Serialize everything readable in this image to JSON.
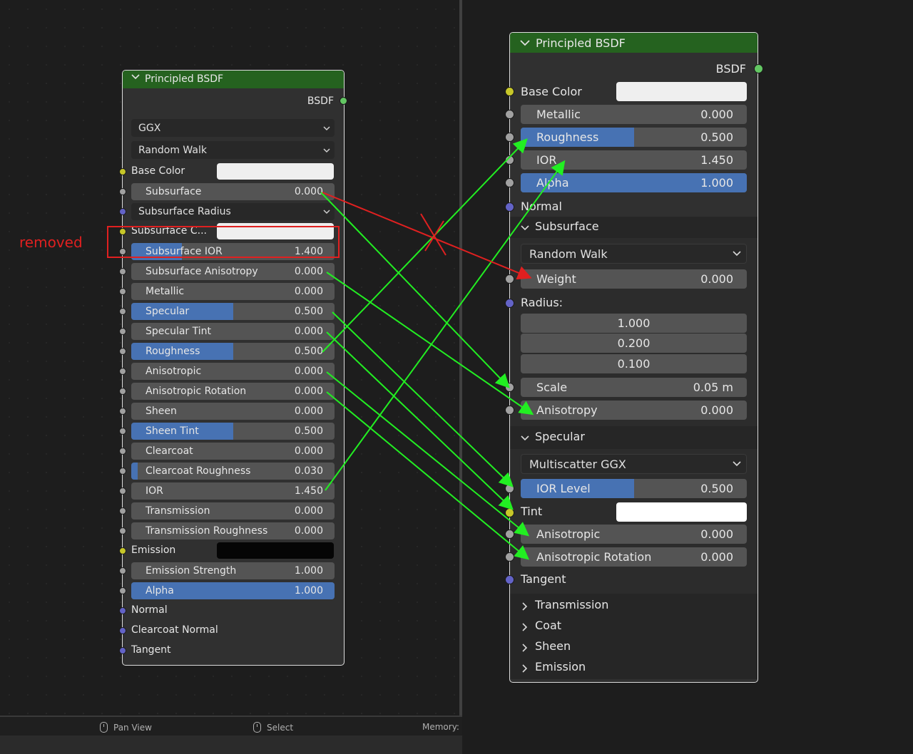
{
  "annotation": {
    "label": "removed"
  },
  "statusbar": {
    "pan": "Pan View",
    "select": "Select",
    "memory": "Memory: "
  },
  "left_node": {
    "title": "Principled BSDF",
    "output": "BSDF",
    "dropdown1": "GGX",
    "dropdown2": "Random Walk",
    "base_color": "Base Color",
    "subsurface": {
      "label": "Subsurface",
      "value": "0.000"
    },
    "subsurface_radius": "Subsurface Radius",
    "subsurface_color": "Subsurface C...",
    "subsurface_ior": {
      "label": "Subsurface IOR",
      "value": "1.400"
    },
    "subsurface_anisotropy": {
      "label": "Subsurface Anisotropy",
      "value": "0.000"
    },
    "metallic": {
      "label": "Metallic",
      "value": "0.000"
    },
    "specular": {
      "label": "Specular",
      "value": "0.500"
    },
    "specular_tint": {
      "label": "Specular Tint",
      "value": "0.000"
    },
    "roughness": {
      "label": "Roughness",
      "value": "0.500"
    },
    "anisotropic": {
      "label": "Anisotropic",
      "value": "0.000"
    },
    "anisotropic_rotation": {
      "label": "Anisotropic Rotation",
      "value": "0.000"
    },
    "sheen": {
      "label": "Sheen",
      "value": "0.000"
    },
    "sheen_tint": {
      "label": "Sheen Tint",
      "value": "0.500"
    },
    "clearcoat": {
      "label": "Clearcoat",
      "value": "0.000"
    },
    "clearcoat_roughness": {
      "label": "Clearcoat Roughness",
      "value": "0.030"
    },
    "ior": {
      "label": "IOR",
      "value": "1.450"
    },
    "transmission": {
      "label": "Transmission",
      "value": "0.000"
    },
    "transmission_roughness": {
      "label": "Transmission Roughness",
      "value": "0.000"
    },
    "emission": "Emission",
    "emission_strength": {
      "label": "Emission Strength",
      "value": "1.000"
    },
    "alpha": {
      "label": "Alpha",
      "value": "1.000"
    },
    "normal": "Normal",
    "clearcoat_normal": "Clearcoat Normal",
    "tangent": "Tangent"
  },
  "right_node": {
    "title": "Principled BSDF",
    "output": "BSDF",
    "base_color": "Base Color",
    "metallic": {
      "label": "Metallic",
      "value": "0.000"
    },
    "roughness": {
      "label": "Roughness",
      "value": "0.500"
    },
    "ior": {
      "label": "IOR",
      "value": "1.450"
    },
    "alpha": {
      "label": "Alpha",
      "value": "1.000"
    },
    "normal": "Normal",
    "subsurface_section": "Subsurface",
    "subsurface_method": "Random Walk",
    "weight": {
      "label": "Weight",
      "value": "0.000"
    },
    "radius": "Radius:",
    "radius_values": [
      "1.000",
      "0.200",
      "0.100"
    ],
    "scale": {
      "label": "Scale",
      "value": "0.05 m"
    },
    "anisotropy": {
      "label": "Anisotropy",
      "value": "0.000"
    },
    "specular_section": "Specular",
    "specular_method": "Multiscatter GGX",
    "ior_level": {
      "label": "IOR Level",
      "value": "0.500"
    },
    "tint": "Tint",
    "anisotropic": {
      "label": "Anisotropic",
      "value": "0.000"
    },
    "anisotropic_rotation": {
      "label": "Anisotropic Rotation",
      "value": "0.000"
    },
    "tangent": "Tangent",
    "collapsed": [
      "Transmission",
      "Coat",
      "Sheen",
      "Emission"
    ]
  },
  "colors": {
    "header": "#25621f",
    "slider_fill": "#4772b3",
    "annotation": "#e02020",
    "arrow": "#22ee22"
  }
}
